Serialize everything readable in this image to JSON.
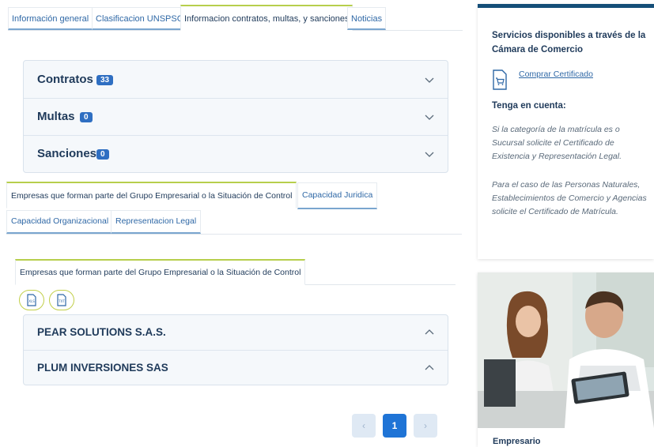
{
  "top_tabs": [
    {
      "label": "Información general"
    },
    {
      "label": "Clasificacion UNSPSC"
    },
    {
      "label": "Informacion contratos, multas, y sanciones"
    },
    {
      "label": "Noticias"
    }
  ],
  "records": [
    {
      "label": "Contratos",
      "count": "33"
    },
    {
      "label": "Multas",
      "count": "0"
    },
    {
      "label": "Sanciones",
      "count": "0"
    }
  ],
  "mid_tabs": [
    {
      "label": "Empresas que forman parte del Grupo Empresarial o la Situación de Control"
    },
    {
      "label": "Capacidad Juridica"
    },
    {
      "label": "Capacidad Organizacional"
    },
    {
      "label": "Representacion Legal"
    }
  ],
  "group_tab": {
    "label": "Empresas que forman parte del Grupo Empresarial o la Situación de Control"
  },
  "download": {
    "xls_label": "XLS",
    "txt_label": "TXT"
  },
  "companies": [
    {
      "name": "PEAR SOLUTIONS S.A.S."
    },
    {
      "name": "PLUM INVERSIONES SAS"
    }
  ],
  "pagination": {
    "current_page": "1",
    "prev": "‹",
    "next": "›"
  },
  "sidebar": {
    "title": "Servicios disponibles a través de la Cámara de Comercio",
    "cert_link": "Comprar Certificado",
    "note_title": "Tenga en cuenta:",
    "note_1": "Si la categoría de la matrícula es o Sucursal solicite el Certificado de Existencia y Representación Legal.",
    "note_2": "Para el caso de las Personas Naturales, Establecimientos de Comercio y Agencias solicite el Certificado de Matrícula.",
    "image_caption": "Empresario"
  },
  "colors": {
    "accent": "#1f74d6",
    "tab_accent": "#b7cf4c",
    "heading": "#1f3a5a",
    "sidebar_bar": "#154e78"
  }
}
